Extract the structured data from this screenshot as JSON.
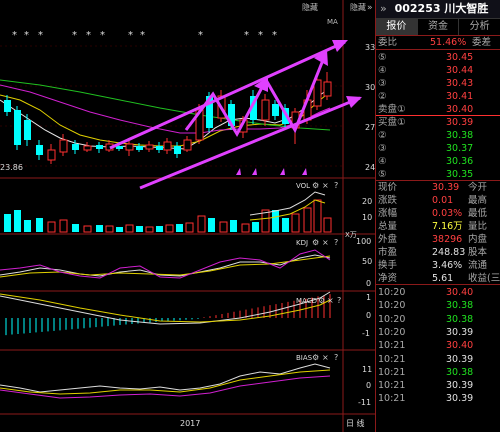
{
  "toolbar": {
    "hide_label": "隐藏",
    "hide_label2": "隐藏",
    "forward_icon": "»"
  },
  "main_chart": {
    "ma_label": "MA",
    "price_ticks": [
      "33",
      "30",
      "27",
      "24"
    ],
    "low_price_label": "23.86",
    "asterisk": "*"
  },
  "vol_panel": {
    "label": "VOL",
    "ticks": [
      "20",
      "10"
    ],
    "unit": "X万"
  },
  "kdj_panel": {
    "label": "KDJ",
    "ticks": [
      "100",
      "50",
      "0"
    ]
  },
  "macd_panel": {
    "label": "MACD",
    "ticks": [
      "1",
      "0",
      "-1"
    ]
  },
  "bias_panel": {
    "label": "BIAS",
    "ticks": [
      "11",
      "0",
      "-11"
    ]
  },
  "x_axis": {
    "year_label": "2017",
    "period_label": "日 线"
  },
  "quote": {
    "code": "002253",
    "name": "川大智胜",
    "tabs": [
      "报价",
      "资金",
      "分析"
    ],
    "wei_bi_label": "委比",
    "wei_bi_value": "51.46%",
    "wei_cha_label": "委差",
    "sell": [
      {
        "label": "⑤",
        "price": "30.45"
      },
      {
        "label": "④",
        "price": "30.44"
      },
      {
        "label": "③",
        "price": "30.43"
      },
      {
        "label": "②",
        "price": "30.41"
      },
      {
        "label": "卖盘①",
        "price": "30.40"
      }
    ],
    "buy": [
      {
        "label": "买盘①",
        "price": "30.39"
      },
      {
        "label": "②",
        "price": "30.38"
      },
      {
        "label": "③",
        "price": "30.37"
      },
      {
        "label": "④",
        "price": "30.36"
      },
      {
        "label": "⑤",
        "price": "30.35"
      }
    ],
    "stats": [
      {
        "label": "现价",
        "value": "30.39",
        "label2": "今开"
      },
      {
        "label": "涨跌",
        "value": "0.01",
        "label2": "最高"
      },
      {
        "label": "涨幅",
        "value": "0.03%",
        "label2": "最低"
      },
      {
        "label": "总量",
        "value": "7.16万",
        "label2": "量比"
      },
      {
        "label": "外盘",
        "value": "38296",
        "label2": "内盘"
      },
      {
        "label": "市盈",
        "value": "248.83",
        "label2": "股本"
      },
      {
        "label": "换手",
        "value": "3.46%",
        "label2": "流通"
      },
      {
        "label": "净资",
        "value": "5.61",
        "label2": "收益(三"
      }
    ],
    "ticks": [
      {
        "time": "10:20",
        "price": "30.40"
      },
      {
        "time": "10:20",
        "price": "30.38"
      },
      {
        "time": "10:20",
        "price": "30.38"
      },
      {
        "time": "10:20",
        "price": "30.39"
      },
      {
        "time": "10:21",
        "price": "30.40"
      },
      {
        "time": "10:21",
        "price": "30.39"
      },
      {
        "time": "10:21",
        "price": "30.38"
      },
      {
        "time": "10:21",
        "price": "30.39"
      },
      {
        "time": "10:21",
        "price": "30.39"
      }
    ]
  },
  "colors": {
    "up": "#ff3030",
    "down": "#00ffff",
    "accent": "#e040ff",
    "bg": "#000000",
    "frame": "#8b1a1a"
  }
}
